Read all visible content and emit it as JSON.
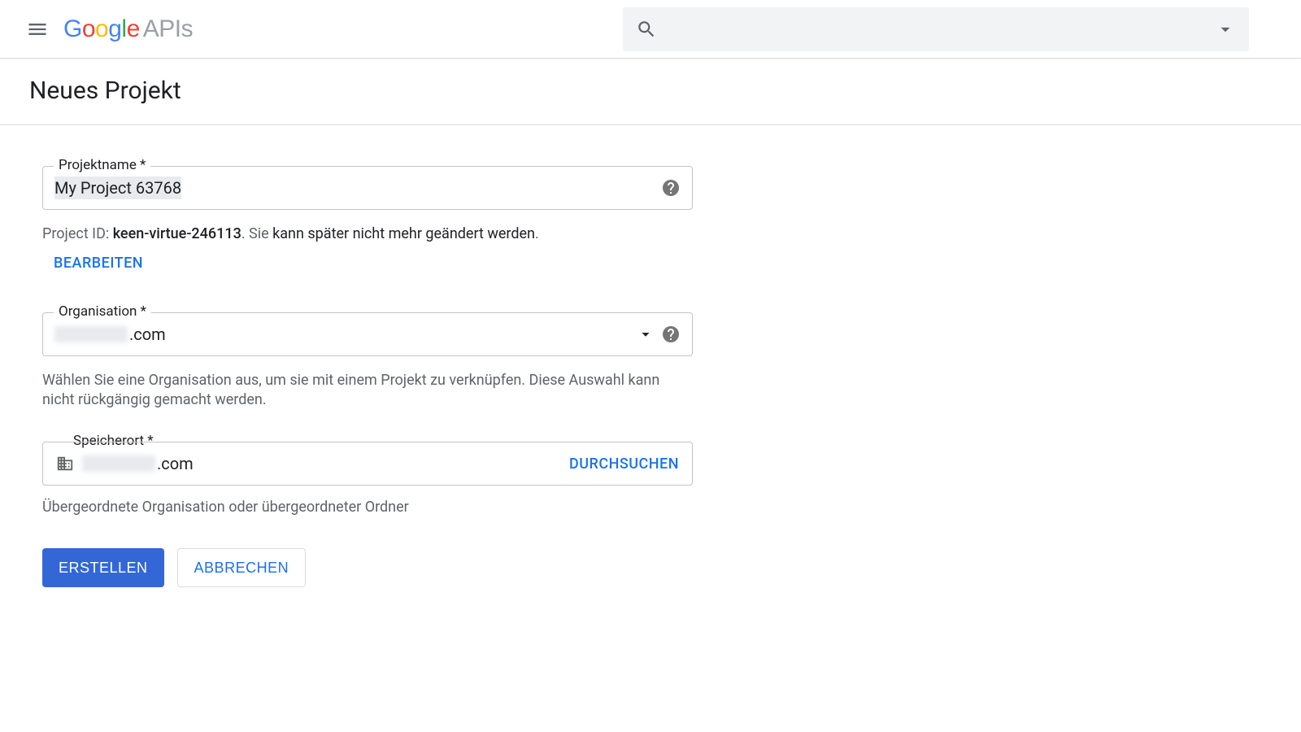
{
  "header": {
    "logo_google": "Google",
    "logo_apis": "APIs"
  },
  "page": {
    "title": "Neues Projekt"
  },
  "projectName": {
    "label": "Projektname *",
    "value": "My Project 63768"
  },
  "projectId": {
    "prefix": "Project ID: ",
    "value": "keen-virtue-246113",
    "note1": ". Sie ",
    "note2": "kann später nicht mehr geändert werden",
    "note3": "."
  },
  "editLink": "BEARBEITEN",
  "organization": {
    "label": "Organisation *",
    "value_suffix": ".com",
    "helper": "Wählen Sie eine Organisation aus, um sie mit einem Projekt zu verknüpfen. Diese Auswahl kann nicht rückgängig gemacht werden."
  },
  "location": {
    "label": "Speicherort *",
    "value_suffix": ".com",
    "browse": "DURCHSUCHEN",
    "helper": "Übergeordnete Organisation oder übergeordneter Ordner"
  },
  "actions": {
    "create": "ERSTELLEN",
    "cancel": "ABBRECHEN"
  }
}
